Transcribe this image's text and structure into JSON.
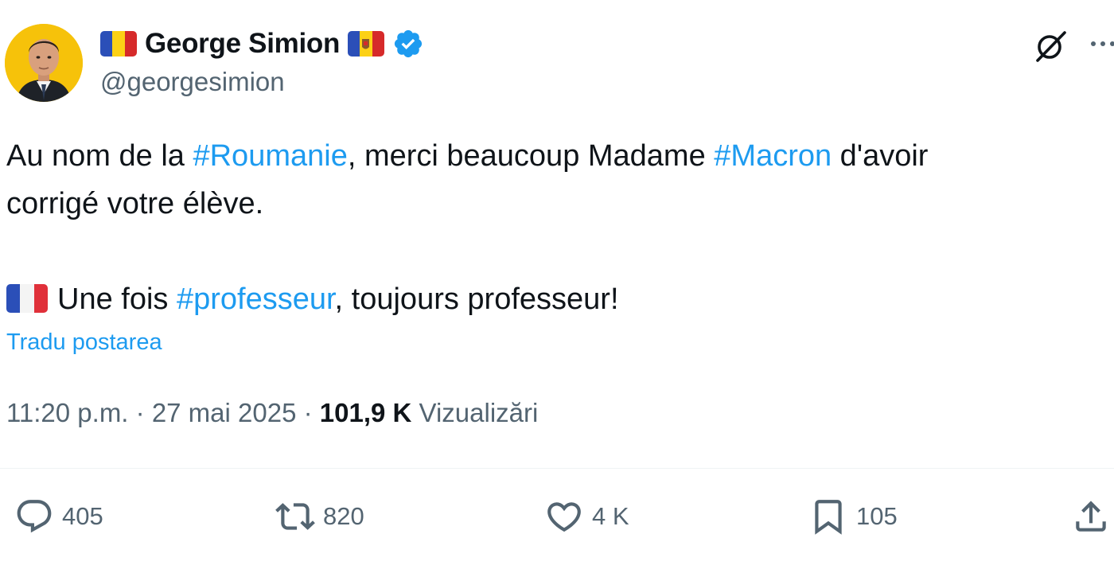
{
  "tweet": {
    "author": {
      "display_name": "George Simion",
      "handle": "@georgesimion",
      "flags": [
        "romania-flag",
        "moldova-flag"
      ],
      "verified": true
    },
    "text": {
      "line1": [
        {
          "t": "Au nom de la ",
          "hashtag": false
        },
        {
          "t": "#Roumanie",
          "hashtag": true
        },
        {
          "t": ", merci beaucoup Madame ",
          "hashtag": false
        },
        {
          "t": "#Macron",
          "hashtag": true
        },
        {
          "t": " d'avoir",
          "hashtag": false
        }
      ],
      "line2": "corrigé votre élève.",
      "line3_prefix": "Une fois ",
      "line3_hashtag": "#professeur",
      "line3_suffix": ", toujours professeur!",
      "line3_flag": "france-flag"
    },
    "translate_link": "Tradu postarea",
    "meta": {
      "time": "11:20 p.m.",
      "separator": " · ",
      "date": "27 mai 2025",
      "views_count": "101,9 K",
      "views_label": "Vizualizări"
    },
    "actions": {
      "replies": "405",
      "reposts": "820",
      "likes": "4 K",
      "bookmarks": "105"
    }
  },
  "colors": {
    "accent": "#1d9bf0",
    "text": "#0f1419",
    "secondary": "#536471",
    "avatar_bg": "#f6c20a"
  },
  "icons": [
    "grok-icon",
    "more-icon",
    "reply-icon",
    "repost-icon",
    "like-icon",
    "bookmark-icon",
    "share-icon",
    "verified-badge-icon"
  ]
}
